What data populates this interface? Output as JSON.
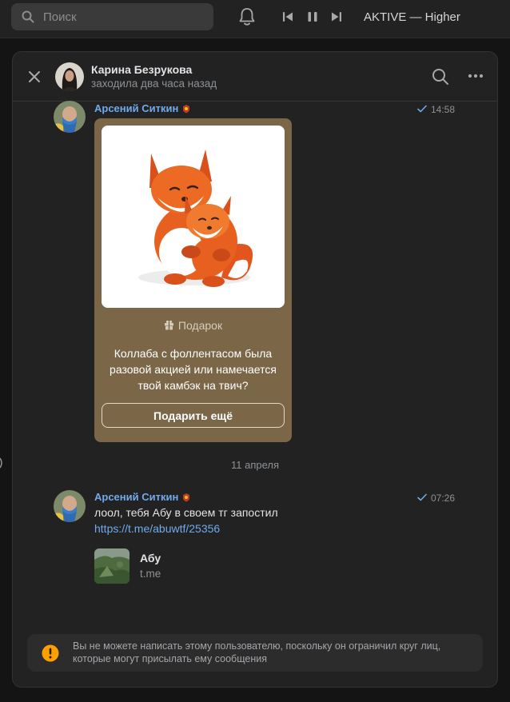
{
  "topbar": {
    "search_placeholder": "Поиск",
    "track": "AKTIVE — Higher"
  },
  "chat": {
    "name": "Карина Безрукова",
    "status": "заходила два часа назад"
  },
  "messages": [
    {
      "author": "Арсений Ситкин",
      "time": "14:58",
      "gift": {
        "label": "Подарок",
        "text": "Коллаба с фоллентасом была разовой акцией или намечается твой камбэк на твич?",
        "button": "Подарить ещё"
      }
    },
    {
      "author": "Арсений Ситкин",
      "time": "07:26",
      "text": "лоол, тебя Абу в своем тг запостил",
      "link": "https://t.me/abuwtf/25356",
      "preview": {
        "title": "Абу",
        "domain": "t.me"
      }
    }
  ],
  "date_separator": "11 апреля",
  "notice": "Вы не можете написать этому пользователю, поскольку он ограничил круг лиц, которые могут присылать ему сообщения",
  "colors": {
    "accent": "#71aaeb",
    "gift_bg": "#7b6748",
    "panel_bg": "#222222",
    "warning": "#ffa000"
  }
}
